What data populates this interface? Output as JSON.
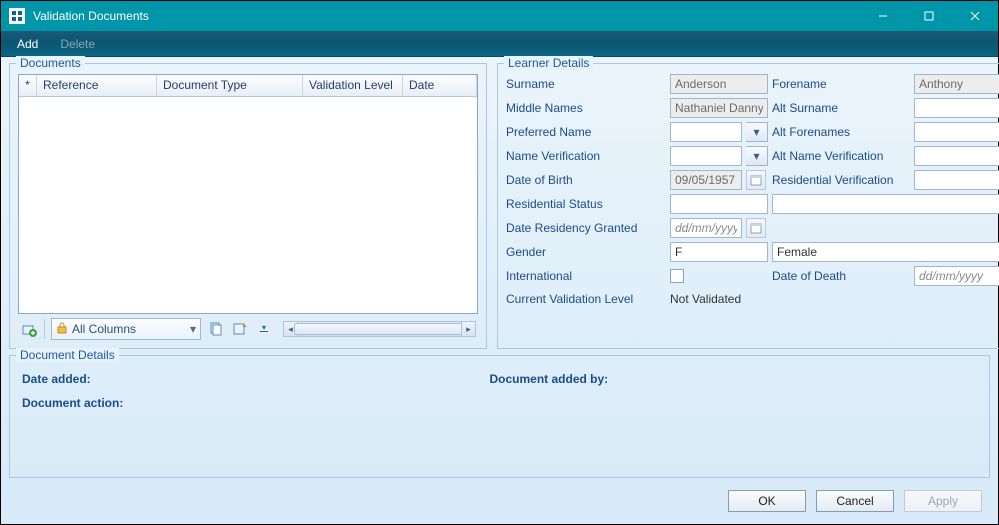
{
  "window": {
    "title": "Validation Documents"
  },
  "menu": {
    "add": "Add",
    "delete": "Delete"
  },
  "documents": {
    "legend": "Documents",
    "columns": {
      "star": "*",
      "reference": "Reference",
      "type": "Document Type",
      "level": "Validation Level",
      "date": "Date"
    },
    "toolbar": {
      "all_columns": "All Columns"
    }
  },
  "learner": {
    "legend": "Learner Details",
    "labels": {
      "surname": "Surname",
      "forename": "Forename",
      "middle": "Middle Names",
      "alt_surname": "Alt Surname",
      "pref_name": "Preferred Name",
      "alt_forenames": "Alt Forenames",
      "name_ver": "Name Verification",
      "alt_name_ver": "Alt Name Verification",
      "dob": "Date of Birth",
      "res_ver": "Residential Verification",
      "res_status": "Residential Status",
      "res_granted": "Date Residency Granted",
      "gender": "Gender",
      "intl": "International",
      "dod": "Date of Death",
      "cur_val": "Current Validation Level"
    },
    "values": {
      "surname": "Anderson",
      "forename": "Anthony",
      "middle": "Nathaniel Danny",
      "alt_surname": "",
      "pref_name": "",
      "alt_forenames": "",
      "name_ver": "",
      "alt_name_ver": "",
      "dob": "09/05/1957",
      "res_ver": "",
      "res_status_code": "",
      "res_status_desc": "",
      "res_granted": "dd/mm/yyyy",
      "gender_code": "F",
      "gender_desc": "Female",
      "intl": false,
      "dod": "dd/mm/yyyy",
      "cur_val": "Not Validated"
    }
  },
  "docdetails": {
    "legend": "Document Details",
    "labels": {
      "added": "Date added:",
      "added_by": "Document added by:",
      "action": "Document action:"
    }
  },
  "buttons": {
    "ok": "OK",
    "cancel": "Cancel",
    "apply": "Apply"
  }
}
